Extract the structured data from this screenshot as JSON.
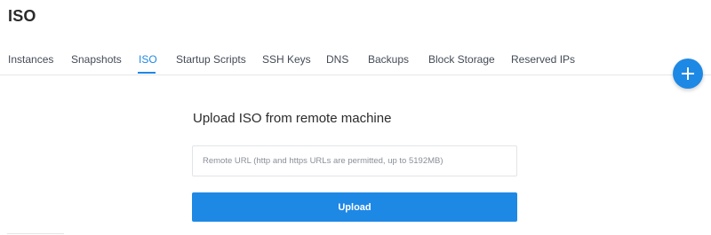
{
  "page": {
    "title": "ISO"
  },
  "tabs": [
    {
      "label": "Instances",
      "active": false
    },
    {
      "label": "Snapshots",
      "active": false
    },
    {
      "label": "ISO",
      "active": true
    },
    {
      "label": "Startup Scripts",
      "active": false
    },
    {
      "label": "SSH Keys",
      "active": false
    },
    {
      "label": "DNS",
      "active": false
    },
    {
      "label": "Backups",
      "active": false
    },
    {
      "label": "Block Storage",
      "active": false
    },
    {
      "label": "Reserved IPs",
      "active": false
    }
  ],
  "fab": {
    "icon": "plus-icon"
  },
  "upload_form": {
    "heading": "Upload ISO from remote machine",
    "url_value": "",
    "url_placeholder": "Remote URL (http and https URLs are permitted, up to 5192MB)",
    "button_label": "Upload"
  },
  "colors": {
    "accent": "#1e88e5",
    "text": "#2b2b2b",
    "tab_text": "#444b57"
  }
}
